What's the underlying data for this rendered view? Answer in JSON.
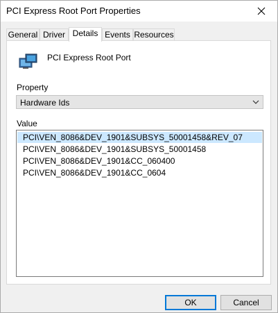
{
  "window": {
    "title": "PCI Express Root Port Properties"
  },
  "tabs": [
    {
      "label": "General"
    },
    {
      "label": "Driver"
    },
    {
      "label": "Details",
      "active": true
    },
    {
      "label": "Events"
    },
    {
      "label": "Resources"
    }
  ],
  "device": {
    "name": "PCI Express Root Port",
    "icon": "device-monitor-icon"
  },
  "property": {
    "label": "Property",
    "selected": "Hardware Ids"
  },
  "value": {
    "label": "Value",
    "items": [
      "PCI\\VEN_8086&DEV_1901&SUBSYS_50001458&REV_07",
      "PCI\\VEN_8086&DEV_1901&SUBSYS_50001458",
      "PCI\\VEN_8086&DEV_1901&CC_060400",
      "PCI\\VEN_8086&DEV_1901&CC_0604"
    ],
    "selected_index": 0
  },
  "buttons": {
    "ok": "OK",
    "cancel": "Cancel"
  },
  "colors": {
    "accent": "#0078d7",
    "selection": "#cce8ff"
  }
}
